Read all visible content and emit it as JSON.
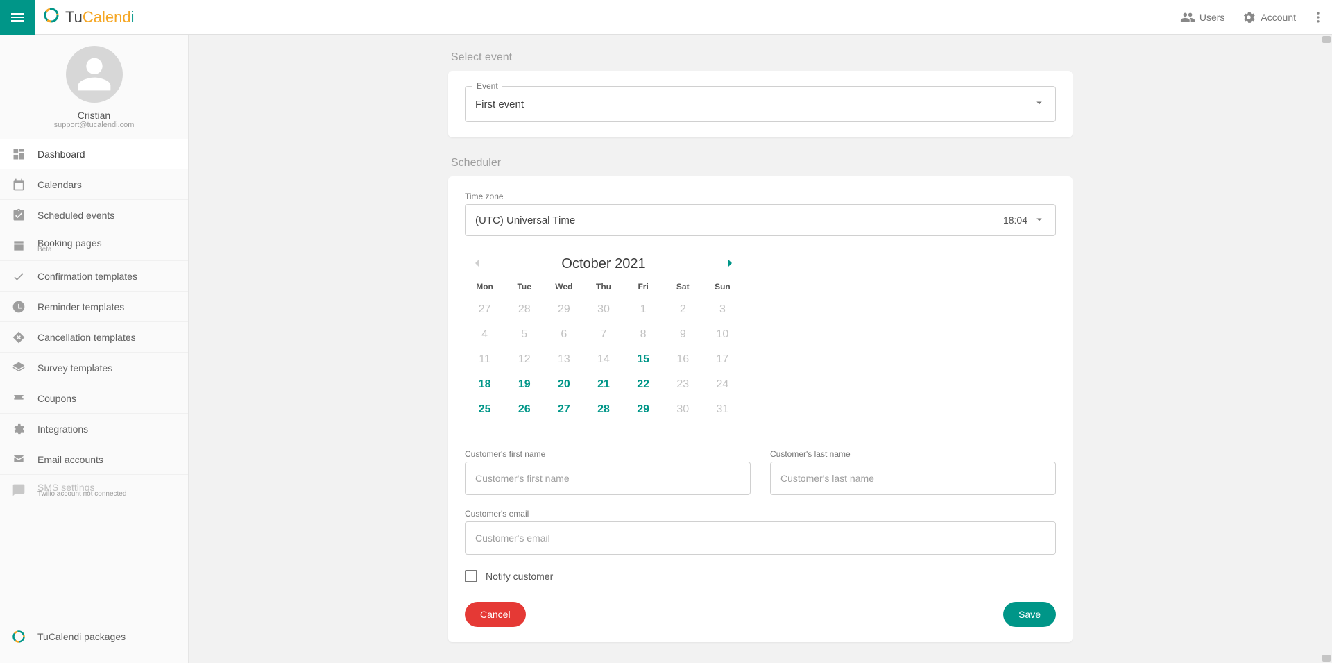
{
  "brand": {
    "tu": "Tu",
    "cal": "Calend",
    "i": "i"
  },
  "topbar": {
    "users_label": "Users",
    "account_label": "Account"
  },
  "profile": {
    "name": "Cristian",
    "email": "support@tucalendi.com"
  },
  "sidebar": {
    "items": [
      {
        "label": "Dashboard"
      },
      {
        "label": "Calendars"
      },
      {
        "label": "Scheduled events"
      },
      {
        "label": "Booking pages",
        "sub": "Beta"
      },
      {
        "label": "Confirmation templates"
      },
      {
        "label": "Reminder templates"
      },
      {
        "label": "Cancellation templates"
      },
      {
        "label": "Survey templates"
      },
      {
        "label": "Coupons"
      },
      {
        "label": "Integrations"
      },
      {
        "label": "Email accounts"
      },
      {
        "label": "SMS settings",
        "sub": "Twilio account not connected"
      }
    ],
    "foot_label": "TuCalendi packages"
  },
  "select_event": {
    "section_title": "Select event",
    "field_legend": "Event",
    "value": "First event"
  },
  "scheduler": {
    "section_title": "Scheduler",
    "tz_label": "Time zone",
    "tz_value": "(UTC) Universal Time",
    "tz_clock": "18:04",
    "month_title": "October 2021",
    "dow": [
      "Mon",
      "Tue",
      "Wed",
      "Thu",
      "Fri",
      "Sat",
      "Sun"
    ],
    "weeks": [
      [
        {
          "n": "27",
          "avail": false
        },
        {
          "n": "28",
          "avail": false
        },
        {
          "n": "29",
          "avail": false
        },
        {
          "n": "30",
          "avail": false
        },
        {
          "n": "1",
          "avail": false
        },
        {
          "n": "2",
          "avail": false
        },
        {
          "n": "3",
          "avail": false
        }
      ],
      [
        {
          "n": "4",
          "avail": false
        },
        {
          "n": "5",
          "avail": false
        },
        {
          "n": "6",
          "avail": false
        },
        {
          "n": "7",
          "avail": false
        },
        {
          "n": "8",
          "avail": false
        },
        {
          "n": "9",
          "avail": false
        },
        {
          "n": "10",
          "avail": false
        }
      ],
      [
        {
          "n": "11",
          "avail": false
        },
        {
          "n": "12",
          "avail": false
        },
        {
          "n": "13",
          "avail": false
        },
        {
          "n": "14",
          "avail": false
        },
        {
          "n": "15",
          "avail": true
        },
        {
          "n": "16",
          "avail": false
        },
        {
          "n": "17",
          "avail": false
        }
      ],
      [
        {
          "n": "18",
          "avail": true
        },
        {
          "n": "19",
          "avail": true
        },
        {
          "n": "20",
          "avail": true
        },
        {
          "n": "21",
          "avail": true
        },
        {
          "n": "22",
          "avail": true
        },
        {
          "n": "23",
          "avail": false
        },
        {
          "n": "24",
          "avail": false
        }
      ],
      [
        {
          "n": "25",
          "avail": true
        },
        {
          "n": "26",
          "avail": true
        },
        {
          "n": "27",
          "avail": true
        },
        {
          "n": "28",
          "avail": true
        },
        {
          "n": "29",
          "avail": true
        },
        {
          "n": "30",
          "avail": false
        },
        {
          "n": "31",
          "avail": false
        }
      ]
    ],
    "first_name_label": "Customer's first name",
    "first_name_ph": "Customer's first name",
    "last_name_label": "Customer's last name",
    "last_name_ph": "Customer's last name",
    "email_label": "Customer's email",
    "email_ph": "Customer's email",
    "notify_label": "Notify customer",
    "cancel_label": "Cancel",
    "save_label": "Save"
  },
  "colors": {
    "accent": "#009688",
    "danger": "#e53935"
  }
}
